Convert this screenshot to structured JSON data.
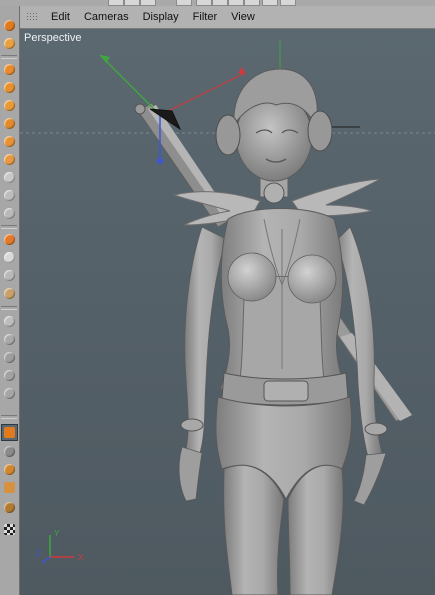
{
  "menu": {
    "items": [
      {
        "label": "Edit"
      },
      {
        "label": "Cameras"
      },
      {
        "label": "Display"
      },
      {
        "label": "Filter"
      },
      {
        "label": "View"
      }
    ]
  },
  "viewport": {
    "label": "Perspective",
    "background_color": "#556169",
    "model_color": "#9c9c9c"
  },
  "world_axis": {
    "x_label": "X",
    "y_label": "Y",
    "z_label": "Z",
    "x_color": "#d23a3a",
    "y_color": "#3ea83e",
    "z_color": "#3b56d8"
  },
  "toolbar": {
    "icons": [
      "move-tool-icon",
      "scale-tool-icon",
      "rotate-tool-icon",
      "sphere-tool-icon",
      "model-mode-icon",
      "object-mode-icon",
      "points-mode-icon",
      "edges-mode-icon",
      "polygons-mode-icon",
      "texture-mode-icon",
      "axis-mode-icon",
      "snap-icon",
      "workplane-icon",
      "lock-icon",
      "cube-icon",
      "light-icon",
      "camera-icon",
      "sculpt-icon",
      "render-icon",
      "render-region-icon",
      "render-settings-icon",
      "hair-icon",
      "particles-icon",
      "checker-icon"
    ]
  }
}
